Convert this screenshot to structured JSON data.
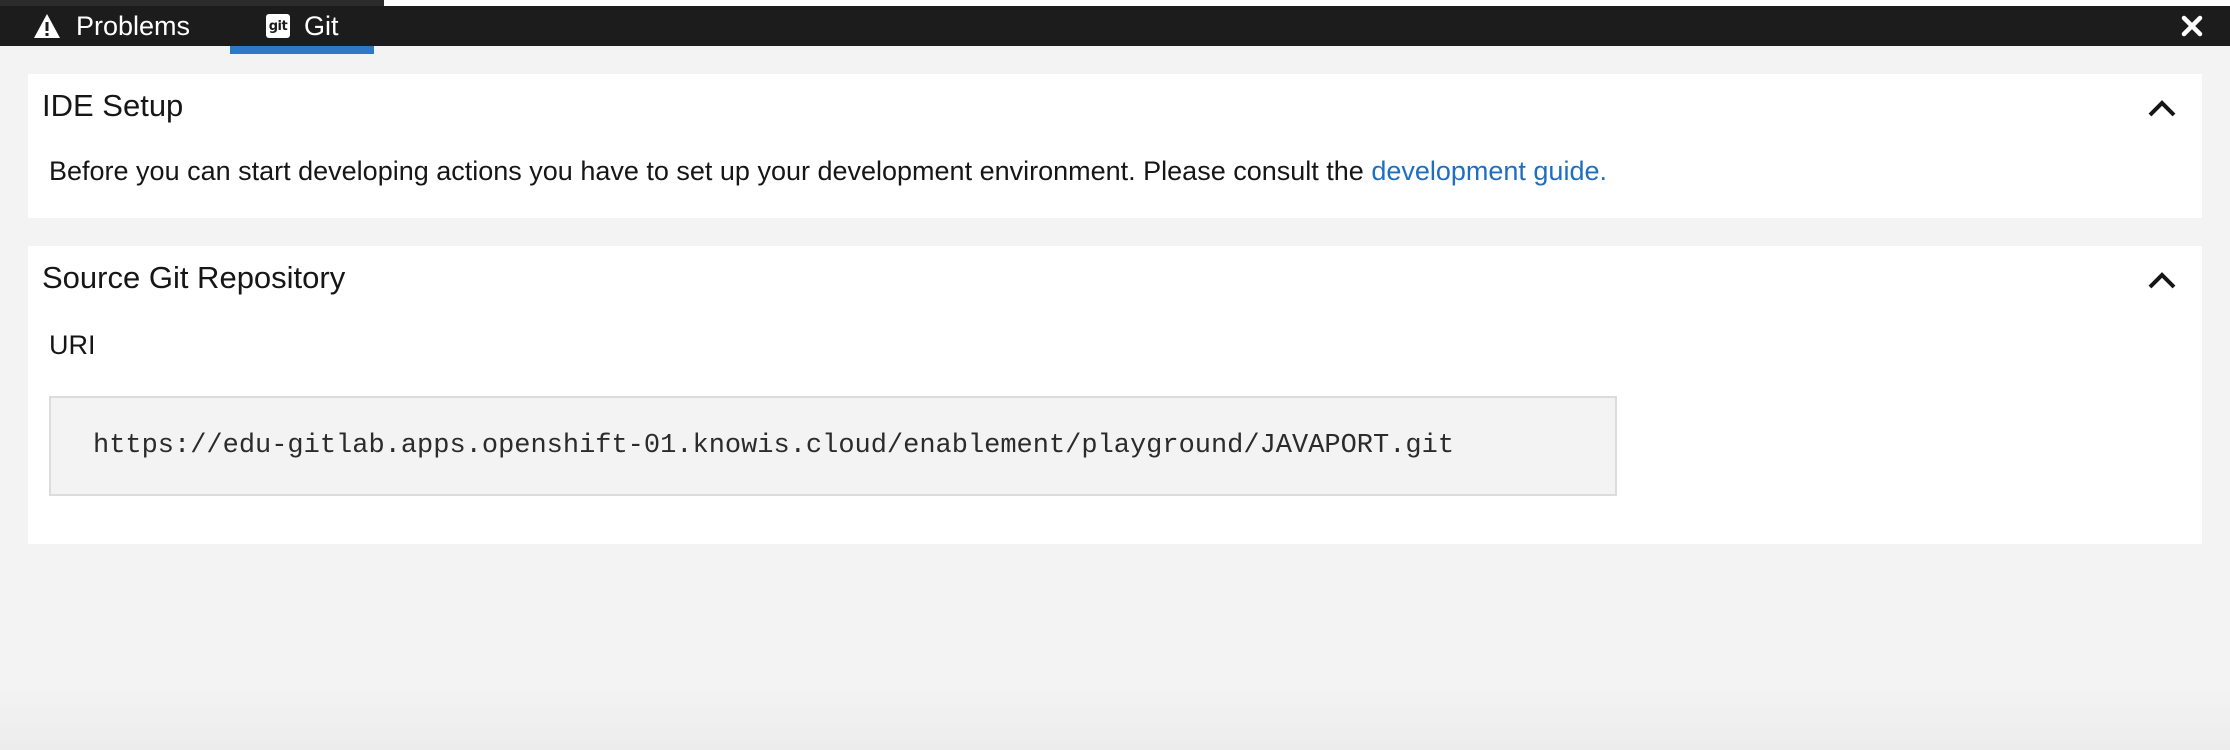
{
  "tabs": [
    {
      "label": "Problems",
      "icon": "warning-icon",
      "active": false
    },
    {
      "label": "Git",
      "icon": "git-icon",
      "icon_text": "git",
      "active": true
    }
  ],
  "close_icon": "close-icon",
  "colors": {
    "tabbar_bg": "#1c1c1c",
    "active_tab_accent": "#2d79c7",
    "link": "#1f6fc1",
    "page_bg": "#f3f3f3"
  },
  "ide_setup": {
    "title": "IDE Setup",
    "body_text": "Before you can start developing actions you have to set up your development environment. Please consult the ",
    "link_text": "development guide.",
    "collapse_icon": "chevron-up-icon"
  },
  "source_git_repository": {
    "title": "Source Git Repository",
    "uri_label": "URI",
    "uri_value": "https://edu-gitlab.apps.openshift-01.knowis.cloud/enablement/playground/JAVAPORT.git",
    "collapse_icon": "chevron-up-icon"
  }
}
